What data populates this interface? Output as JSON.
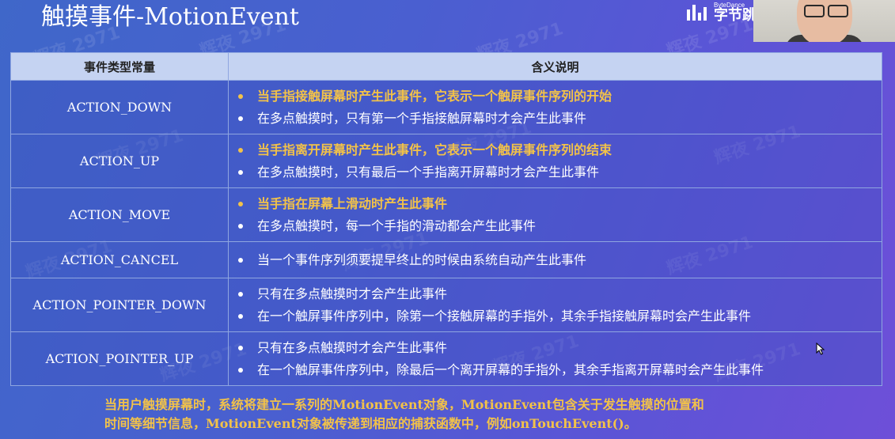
{
  "slide": {
    "title": "触摸事件-MotionEvent",
    "watermark_text": "辉夜 2971",
    "logo": {
      "small": "ByteDance",
      "big": "字节跳"
    }
  },
  "table": {
    "headers": [
      "事件类型常量",
      "含义说明"
    ],
    "rows": [
      {
        "constant": "ACTION_DOWN",
        "lines": [
          {
            "text": "当手指接触屏幕时产生此事件，它表示一个触屏事件序列的开始",
            "highlight": true
          },
          {
            "text": "在多点触摸时，只有第一个手指接触屏幕时才会产生此事件",
            "highlight": false
          }
        ]
      },
      {
        "constant": "ACTION_UP",
        "lines": [
          {
            "text": "当手指离开屏幕时产生此事件，它表示一个触屏事件序列的结束",
            "highlight": true
          },
          {
            "text": "在多点触摸时，只有最后一个手指离开屏幕时才会产生此事件",
            "highlight": false
          }
        ]
      },
      {
        "constant": "ACTION_MOVE",
        "lines": [
          {
            "text": "当手指在屏幕上滑动时产生此事件",
            "highlight": true
          },
          {
            "text": " 在多点触摸时，每一个手指的滑动都会产生此事件",
            "highlight": false
          }
        ]
      },
      {
        "constant": "ACTION_CANCEL",
        "lines": [
          {
            "text": "当一个事件序列须要提早终止的时候由系统自动产生此事件",
            "highlight": false
          }
        ]
      },
      {
        "constant": "ACTION_POINTER_DOWN",
        "lines": [
          {
            "text": "只有在多点触摸时才会产生此事件",
            "highlight": false
          },
          {
            "text": "在一个触屏事件序列中，除第一个接触屏幕的手指外，其余手指接触屏幕时会产生此事件",
            "highlight": false
          }
        ]
      },
      {
        "constant": "ACTION_POINTER_UP",
        "lines": [
          {
            "text": "只有在多点触摸时才会产生此事件",
            "highlight": false
          },
          {
            "text": "在一个触屏事件序列中，除最后一个离开屏幕的手指外，其余手指离开屏幕时会产生此事件",
            "highlight": false
          }
        ]
      }
    ]
  },
  "footer": {
    "line1": "当用户触摸屏幕时，系统将建立一系列的MotionEvent对象，MotionEvent包含关于发生触摸的位置和",
    "line2": "时间等细节信息，MotionEvent对象被传递到相应的捕获函数中，例如onTouchEvent()。"
  },
  "colors": {
    "highlight": "#f2c249",
    "header_bg": "#c5d3f2",
    "border": "#8fa6e0"
  }
}
